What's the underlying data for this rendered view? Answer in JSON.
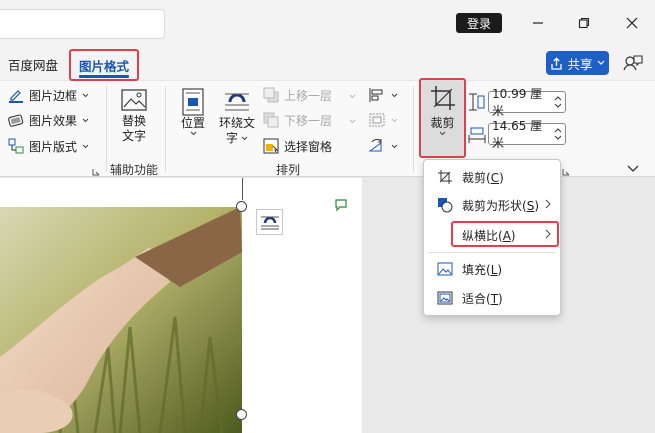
{
  "titlebar": {
    "login_label": "登录"
  },
  "tabs": {
    "baidu": "百度网盘",
    "picture_format": "图片格式"
  },
  "share": {
    "label": "共享"
  },
  "ribbon": {
    "picture_styles": {
      "border": "图片边框",
      "effects": "图片效果",
      "layout": "图片版式"
    },
    "accessibility": {
      "alt_text_line1": "替换",
      "alt_text_line2": "文字",
      "group_label": "辅助功能"
    },
    "arrange": {
      "position": "位置",
      "wrap_text_line1": "环绕文",
      "wrap_text_line2": "字",
      "bring_forward": "上移一层",
      "send_backward": "下移一层",
      "selection_pane": "选择窗格",
      "group_label": "排列"
    },
    "crop": {
      "label": "裁剪"
    },
    "size": {
      "height": "10.99 厘米",
      "width": "14.65 厘米"
    }
  },
  "crop_menu": {
    "items": [
      {
        "label": "裁剪(C)",
        "underline": "C",
        "submenu": false
      },
      {
        "label": "裁剪为形状(S)",
        "underline": "S",
        "submenu": true
      },
      {
        "label": "纵横比(A)",
        "underline": "A",
        "submenu": true
      },
      {
        "label": "填充(L)",
        "underline": "L",
        "submenu": false
      },
      {
        "label": "适合(T)",
        "underline": "T",
        "submenu": false
      }
    ]
  },
  "colors": {
    "accent": "#1a56b8",
    "share_bg": "#1d5fc4",
    "highlight": "#e0404e"
  }
}
